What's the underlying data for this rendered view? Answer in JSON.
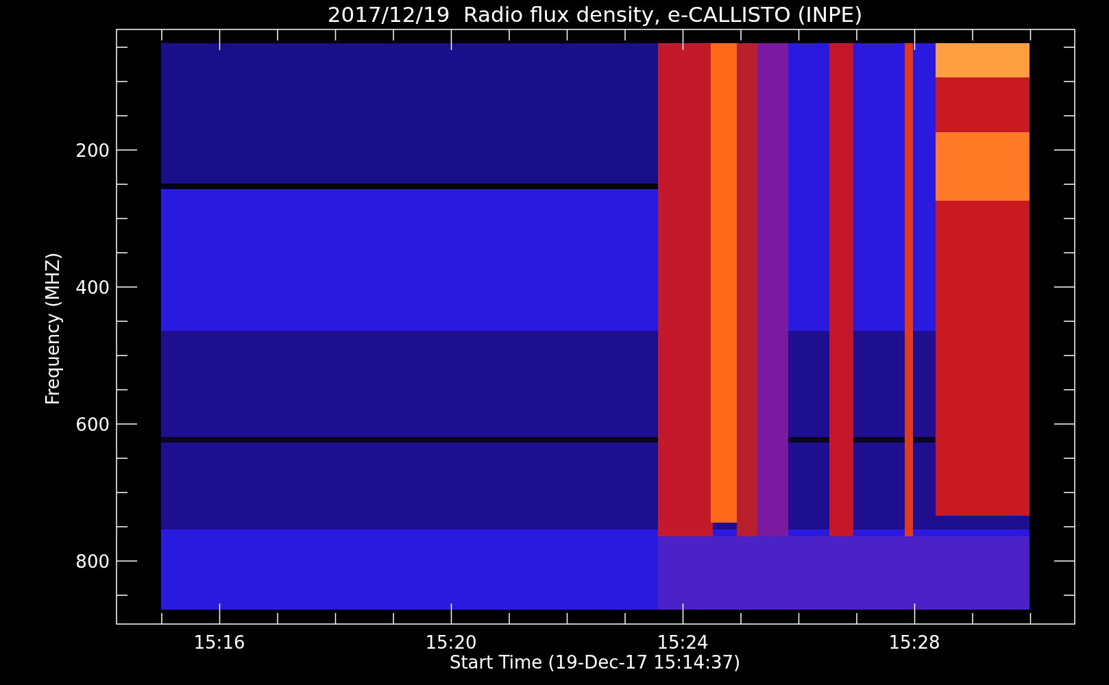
{
  "title": "2017/12/19  Radio flux density, e-CALLISTO (INPE)",
  "y_axis": {
    "label": "Frequency (MHZ)",
    "tick_labels": [
      "200",
      "400",
      "600",
      "800"
    ]
  },
  "x_axis": {
    "label": "Start Time (19-Dec-17 15:14:37)",
    "tick_labels": [
      "15:16",
      "15:20",
      "15:24",
      "15:28"
    ]
  }
}
